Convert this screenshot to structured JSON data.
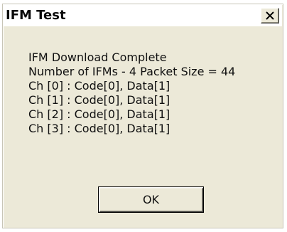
{
  "window": {
    "title": "IFM Test"
  },
  "icons": {
    "close": "close-icon"
  },
  "message": {
    "lines": [
      "IFM Download Complete",
      "Number of IFMs - 4 Packet Size = 44",
      "Ch [0] : Code[0], Data[1]",
      "Ch [1] : Code[0], Data[1]",
      "Ch [2] : Code[0], Data[1]",
      "Ch [3] : Code[0], Data[1]"
    ]
  },
  "buttons": {
    "ok_label": "OK"
  }
}
